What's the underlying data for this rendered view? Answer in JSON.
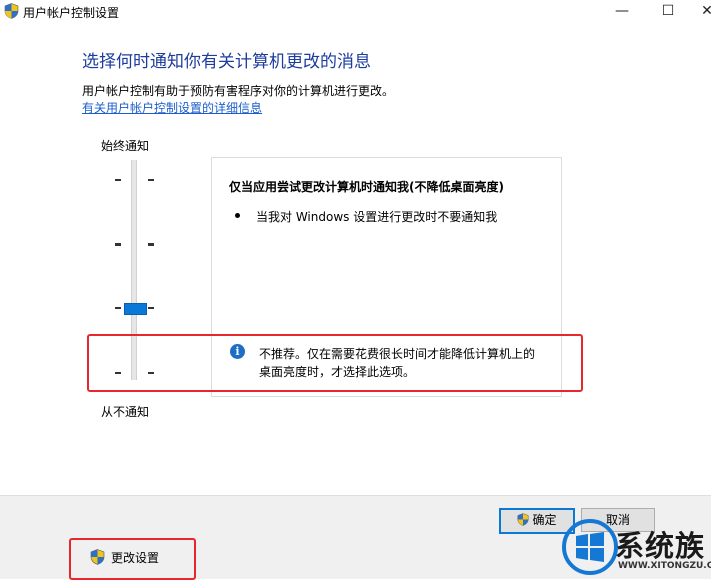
{
  "window": {
    "title": "用户帐户控制设置",
    "controls": {
      "minimize": "—",
      "maximize": "☐",
      "close": "✕"
    }
  },
  "main": {
    "heading": "选择何时通知你有关计算机更改的消息",
    "description": "用户帐户控制有助于预防有害程序对你的计算机进行更改。",
    "link": "有关用户帐户控制设置的详细信息"
  },
  "slider": {
    "top_label": "始终通知",
    "bottom_label": "从不通知",
    "levels": 4,
    "selected_level": 2
  },
  "panel": {
    "title": "仅当应用尝试更改计算机时通知我(不降低桌面亮度)",
    "bullet": "当我对 Windows 设置进行更改时不要通知我",
    "info_line1": "不推荐。仅在需要花费很长时间才能降低计算机上的",
    "info_line2": "桌面亮度时，才选择此选项。"
  },
  "footer": {
    "ok_label": "确定",
    "cancel_label": "取消",
    "change_settings_label": "更改设置"
  },
  "watermark": {
    "text": "系统族",
    "url": "WWW.XITONGZU.COM"
  },
  "colors": {
    "heading": "#1c3c9e",
    "link": "#1b5ecb",
    "slider_thumb": "#0a78d7",
    "highlight_box": "#e8262b",
    "info_icon": "#1d6fc6"
  }
}
